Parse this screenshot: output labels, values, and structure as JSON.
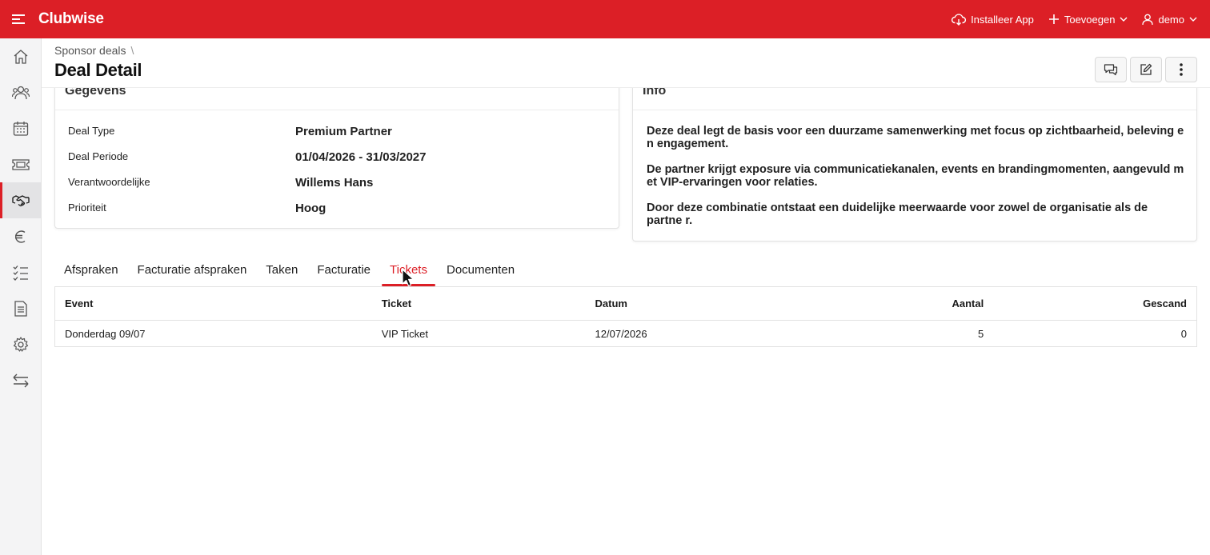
{
  "app": {
    "brand": "Clubwise",
    "install_label": "Installeer App",
    "add_label": "Toevoegen",
    "user_label": "demo"
  },
  "sidebar": {
    "items": [
      {
        "icon": "home-icon"
      },
      {
        "icon": "users-icon"
      },
      {
        "icon": "calendar-icon"
      },
      {
        "icon": "ticket-icon"
      },
      {
        "icon": "handshake-icon",
        "active": true
      },
      {
        "icon": "euro-icon"
      },
      {
        "icon": "checklist-icon"
      },
      {
        "icon": "document-icon"
      },
      {
        "icon": "gear-icon"
      },
      {
        "icon": "transfer-icon"
      }
    ]
  },
  "header": {
    "breadcrumb": "Sponsor deals",
    "breadcrumb_sep": "\\",
    "title": "Deal Detail"
  },
  "gegevens": {
    "title": "Gegevens",
    "fields": [
      {
        "label": "Deal Type",
        "value": "Premium Partner"
      },
      {
        "label": "Deal Periode",
        "value": "01/04/2026 - 31/03/2027"
      },
      {
        "label": "Verantwoordelijke",
        "value": "Willems Hans"
      },
      {
        "label": "Prioriteit",
        "value": "Hoog"
      }
    ]
  },
  "info": {
    "title": "Info",
    "paragraphs": [
      "Deze deal legt de basis voor een duurzame samenwerking met focus op zichtbaarheid, beleving e n engagement.",
      "De partner krijgt exposure via communicatiekanalen, events en brandingmomenten, aangevuld m et VIP-ervaringen voor relaties.",
      "Door deze combinatie ontstaat een duidelijke meerwaarde voor zowel de organisatie als de partne r."
    ]
  },
  "tabs": [
    {
      "label": "Afspraken"
    },
    {
      "label": "Facturatie afspraken"
    },
    {
      "label": "Taken"
    },
    {
      "label": "Facturatie"
    },
    {
      "label": "Tickets",
      "active": true
    },
    {
      "label": "Documenten"
    }
  ],
  "table": {
    "headers": [
      "Event",
      "Ticket",
      "Datum",
      "Aantal",
      "Gescand"
    ],
    "rows": [
      [
        "Donderdag 09/07",
        "VIP Ticket",
        "12/07/2026",
        "5",
        "0"
      ]
    ]
  },
  "colors": {
    "brand": "#dc1f26"
  }
}
